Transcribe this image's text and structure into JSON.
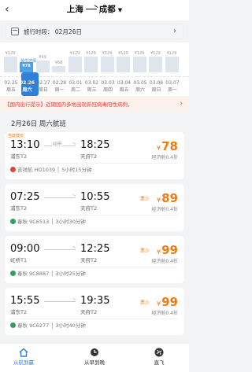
{
  "header": {
    "back_icon": "chevron-left-icon",
    "from_city": "上海",
    "to_city": "成都",
    "dropdown_icon": "caret-down-icon"
  },
  "date_bar": {
    "label": "旅行时段：",
    "date": "02月26日",
    "calendar_icon": "calendar-icon",
    "chevron_icon": "chevron-right-icon"
  },
  "price_calendar": {
    "lowest_tag": "最优选择",
    "days": [
      {
        "price": "¥129",
        "date": "02.25",
        "week": "周五",
        "bar": 0.7,
        "active": false
      },
      {
        "price": "¥78",
        "date": "02.26",
        "week": "周六",
        "bar": 0.45,
        "active": true
      },
      {
        "price": "¥99",
        "date": "02.27",
        "week": "周日",
        "bar": 0.52,
        "active": false
      },
      {
        "price": "¥68",
        "date": "02.28",
        "week": "周一",
        "bar": 0.28,
        "active": false
      },
      {
        "price": "¥129",
        "date": "03.01",
        "week": "周二",
        "bar": 0.7,
        "active": false
      },
      {
        "price": "¥129",
        "date": "03.02",
        "week": "周三",
        "bar": 0.7,
        "active": false
      },
      {
        "price": "¥129",
        "date": "03.03",
        "week": "周四",
        "bar": 0.7,
        "active": false
      },
      {
        "price": "¥129",
        "date": "03.04",
        "week": "周五",
        "bar": 0.7,
        "active": false
      },
      {
        "price": "¥129",
        "date": "03.05",
        "week": "周六",
        "bar": 0.7,
        "active": false
      },
      {
        "price": "¥129",
        "date": "03.06",
        "week": "周日",
        "bar": 0.7,
        "active": false
      },
      {
        "price": "¥129",
        "date": "03.07",
        "week": "周一",
        "bar": 0.7,
        "active": false
      }
    ]
  },
  "notice": {
    "text": "【国内出行提示】近期国内多地出现新冠病毒阳性病例，",
    "chevron_icon": "chevron-right-icon"
  },
  "day_title": "2月26日 周六航班",
  "flights": [
    {
      "badge": "当日低价",
      "dep_time": "13:10",
      "arr_time": "18:25",
      "stop": "经停",
      "dep_airport": "浦东T2",
      "arr_airport": "天府T2",
      "airline": "吉祥航 HO1039 │ 5小时15分钟",
      "logo_color": "#e0463b",
      "few": "",
      "price": "78",
      "cabin": "经济舱0.4折"
    },
    {
      "badge": "",
      "dep_time": "07:25",
      "arr_time": "10:55",
      "stop": "",
      "dep_airport": "浦东T2",
      "arr_airport": "天府T2",
      "airline": "春秋 9C6513 │ 3小时30分钟",
      "logo_color": "#31a05a",
      "few": "票少",
      "price": "89",
      "cabin": "经济舱0.4折"
    },
    {
      "badge": "",
      "dep_time": "09:00",
      "arr_time": "12:25",
      "stop": "",
      "dep_airport": "虹桥T1",
      "arr_airport": "天府T2",
      "airline": "春秋 9C8887 │ 3小时25分钟",
      "logo_color": "#31a05a",
      "few": "票少",
      "price": "99",
      "cabin": "经济舱0.4折"
    },
    {
      "badge": "",
      "dep_time": "15:55",
      "arr_time": "19:35",
      "stop": "",
      "dep_airport": "浦东T2",
      "arr_airport": "天府T2",
      "airline": "春秋 9C6277 │ 3小时40分钟",
      "logo_color": "#31a05a",
      "few": "票少",
      "price": "99",
      "cabin": "经济舱0.4折"
    }
  ],
  "price_currency": "¥",
  "tabs": [
    {
      "label": "从航到赢",
      "icon": "home-icon",
      "active": true
    },
    {
      "label": "从早到晚",
      "icon": "clock-icon",
      "active": false
    },
    {
      "label": "直飞",
      "icon": "plane-icon",
      "active": false
    }
  ],
  "colors": {
    "accent": "#2f80d8",
    "price": "#f07a16",
    "alert": "#e0463b"
  }
}
